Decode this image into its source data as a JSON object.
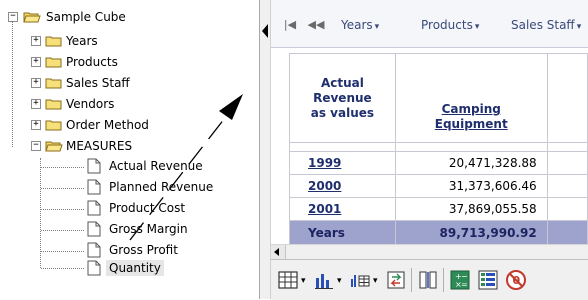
{
  "tree": {
    "root": "Sample Cube",
    "children": [
      {
        "label": "Years"
      },
      {
        "label": "Products"
      },
      {
        "label": "Sales Staff"
      },
      {
        "label": "Vendors"
      },
      {
        "label": "Order Method"
      },
      {
        "label": "MEASURES"
      }
    ],
    "measures": [
      {
        "label": "Actual Revenue"
      },
      {
        "label": "Planned Revenue"
      },
      {
        "label": "Product Cost"
      },
      {
        "label": "Gross Margin"
      },
      {
        "label": "Gross Profit"
      },
      {
        "label": "Quantity"
      }
    ],
    "toggle_expand": "+",
    "toggle_collapse": "−"
  },
  "toolbar": {
    "first_label": "|◀",
    "prev_label": "◀◀",
    "dims": [
      {
        "label": "Years",
        "caret": "▾"
      },
      {
        "label": "Products",
        "caret": "▾"
      },
      {
        "label": "Sales Staff",
        "caret": "▾"
      }
    ]
  },
  "grid": {
    "corner_header": [
      "Actual",
      "Revenue",
      "as values"
    ],
    "column_header": [
      "Camping",
      "Equipment"
    ],
    "rows": [
      {
        "label": "1999",
        "value": "20,471,328.88"
      },
      {
        "label": "2000",
        "value": "31,373,606.46"
      },
      {
        "label": "2001",
        "value": "37,869,055.58"
      }
    ],
    "total": {
      "label": "Years",
      "value": "89,713,990.92"
    }
  },
  "icons": {
    "colors": {
      "accent": "#1f2f6e",
      "total_row": "#9da3cc",
      "chart_blue": "#2b4fb8",
      "icon_green": "#2e8b57",
      "icon_red": "#c0392b"
    }
  }
}
